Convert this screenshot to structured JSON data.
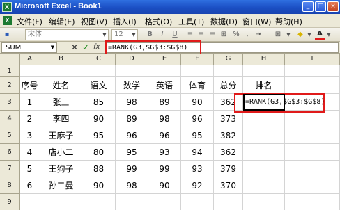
{
  "window": {
    "title": "Microsoft Excel - Book1",
    "app_icon": "excel-icon",
    "buttons": {
      "minimize": "_",
      "maximize": "□",
      "close": "×"
    }
  },
  "menu": {
    "items": [
      "文件(F)",
      "编辑(E)",
      "视图(V)",
      "插入(I)",
      "格式(O)",
      "工具(T)",
      "数据(D)",
      "窗口(W)",
      "帮助(H)"
    ]
  },
  "toolbar": {
    "font_name": "宋体",
    "font_size": "12",
    "bold": "B",
    "italic": "I",
    "underline": "U",
    "font_color_label": "A",
    "icons": [
      "save-icon",
      "bold-icon",
      "italic-icon",
      "underline-icon",
      "align-left-icon",
      "align-center-icon",
      "align-right-icon",
      "merge-icon",
      "percent-icon",
      "decimal-icon",
      "indent-icon",
      "borders-icon",
      "fill-color-icon",
      "font-color-icon"
    ]
  },
  "formula_bar": {
    "name_box": "SUM",
    "cancel": "✕",
    "enter": "✓",
    "fx": "fx",
    "formula": "=RANK(G3,$G$3:$G$8)"
  },
  "sheet": {
    "columns": [
      "A",
      "B",
      "C",
      "D",
      "E",
      "F",
      "G",
      "H",
      "I"
    ],
    "rows": [
      "1",
      "2",
      "3",
      "4",
      "5",
      "6",
      "7",
      "8",
      "9"
    ],
    "headers": [
      "序号",
      "姓名",
      "语文",
      "数学",
      "英语",
      "体育",
      "总分",
      "排名"
    ],
    "data": [
      [
        "1",
        "张三",
        "85",
        "98",
        "89",
        "90",
        "362"
      ],
      [
        "2",
        "李四",
        "90",
        "89",
        "98",
        "96",
        "373"
      ],
      [
        "3",
        "王麻子",
        "95",
        "96",
        "96",
        "95",
        "382"
      ],
      [
        "4",
        "店小二",
        "80",
        "95",
        "93",
        "94",
        "362"
      ],
      [
        "5",
        "王狗子",
        "88",
        "99",
        "99",
        "93",
        "379"
      ],
      [
        "6",
        "孙二曼",
        "90",
        "98",
        "90",
        "92",
        "370"
      ]
    ],
    "active_cell_formula": "=RANK(G3,$G$3:$G$8)"
  },
  "colors": {
    "highlight": "#e01a1a",
    "titlebar": "#1b4fc4"
  }
}
